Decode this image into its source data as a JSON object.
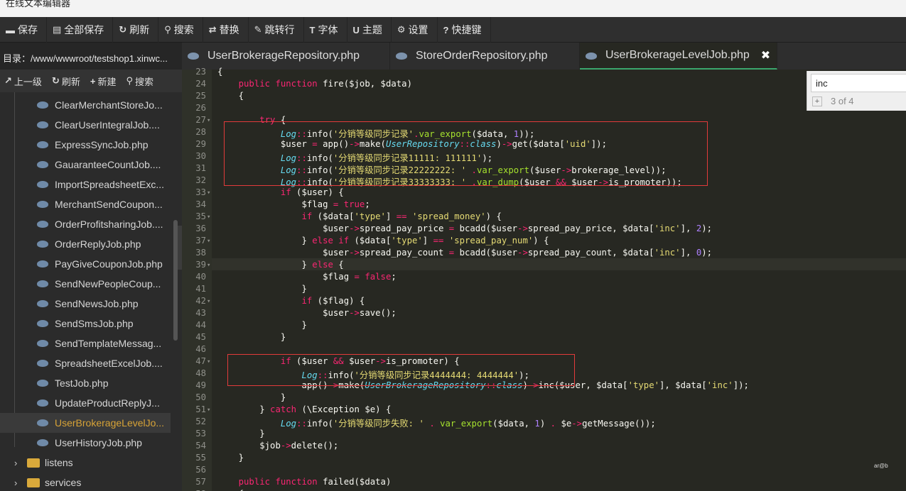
{
  "window": {
    "title": "在线文本编辑器"
  },
  "toolbar": {
    "buttons": [
      {
        "label": "保存",
        "icon": "save-icon",
        "glyph": "▬"
      },
      {
        "label": "全部保存",
        "icon": "save-all-icon",
        "glyph": "▤"
      },
      {
        "label": "刷新",
        "icon": "refresh-icon",
        "glyph": "↻"
      },
      {
        "label": "搜索",
        "icon": "search-icon",
        "glyph": "⚲"
      },
      {
        "label": "替换",
        "icon": "replace-icon",
        "glyph": "⇄"
      },
      {
        "label": "跳转行",
        "icon": "pin-icon",
        "glyph": "✎"
      },
      {
        "label": "字体",
        "icon": "font-icon",
        "glyph": "T"
      },
      {
        "label": "主题",
        "icon": "theme-icon",
        "glyph": "U"
      },
      {
        "label": "设置",
        "icon": "gear-icon",
        "glyph": "⚙"
      },
      {
        "label": "快捷键",
        "icon": "help-icon",
        "glyph": "?"
      }
    ]
  },
  "sidebar": {
    "directory": "目录：/www/wwwroot/testshop1.xinwc...",
    "actions": [
      {
        "label": "上一级",
        "icon": "up-level-icon",
        "glyph": "↗"
      },
      {
        "label": "刷新",
        "icon": "refresh-icon",
        "glyph": "↻"
      },
      {
        "label": "新建",
        "icon": "plus-icon",
        "glyph": "+"
      },
      {
        "label": "搜索",
        "icon": "search-icon",
        "glyph": "⚲"
      }
    ],
    "files": [
      "ClearMerchantStoreJo...",
      "ClearUserIntegralJob....",
      "ExpressSyncJob.php",
      "GauaranteeCountJob....",
      "ImportSpreadsheetExc...",
      "MerchantSendCoupon...",
      "OrderProfitsharingJob....",
      "OrderReplyJob.php",
      "PayGiveCouponJob.php",
      "SendNewPeopleCoup...",
      "SendNewsJob.php",
      "SendSmsJob.php",
      "SendTemplateMessag...",
      "SpreadsheetExcelJob....",
      "TestJob.php",
      "UpdateProductReplyJ...",
      "UserBrokerageLevelJo...",
      "UserHistoryJob.php"
    ],
    "active_file_index": 16,
    "folders": [
      "listens",
      "services"
    ]
  },
  "tabs": [
    {
      "label": "UserBrokerageRepository.php",
      "active": false
    },
    {
      "label": "StoreOrderRepository.php",
      "active": false
    },
    {
      "label": "UserBrokerageLevelJob.php",
      "active": true,
      "close": "✖"
    }
  ],
  "search": {
    "value": "inc",
    "plus": "+",
    "count": "3 of 4"
  },
  "editor": {
    "first_line": 23,
    "lines": [
      "{",
      "    public function fire($job, $data)",
      "    {",
      "",
      "        try {",
      "            Log::info('分销等级同步记录'.var_export($data, 1));",
      "            $user = app()->make(UserRepository::class)->get($data['uid']);",
      "            Log::info('分销等级同步记录11111: 111111');",
      "            Log::info('分销等级同步记录22222222: ' .var_export($user->brokerage_level));",
      "            Log::info('分销等级同步记录33333333: ' .var_dump($user && $user->is_promoter));",
      "            if ($user) {",
      "                $flag = true;",
      "                if ($data['type'] == 'spread_money') {",
      "                    $user->spread_pay_price = bcadd($user->spread_pay_price, $data['inc'], 2);",
      "                } else if ($data['type'] == 'spread_pay_num') {",
      "                    $user->spread_pay_count = bcadd($user->spread_pay_count, $data['inc'], 0);",
      "                } else {",
      "                    $flag = false;",
      "                }",
      "                if ($flag) {",
      "                    $user->save();",
      "                }",
      "            }",
      "",
      "            if ($user && $user->is_promoter) {",
      "                Log::info('分销等级同步记录4444444: 4444444');",
      "                app()->make(UserBrokerageRepository::class)->inc($user, $data['type'], $data['inc']);",
      "            }",
      "        } catch (\\Exception $e) {",
      "            Log::info('分销等级同步失败: ' . var_export($data, 1) . $e->getMessage());",
      "        }",
      "        $job->delete();",
      "    }",
      "",
      "    public function failed($data)",
      "    {"
    ],
    "fold_lines": [
      27,
      33,
      35,
      37,
      39,
      42,
      47,
      51
    ]
  },
  "watermark": "ar@b"
}
